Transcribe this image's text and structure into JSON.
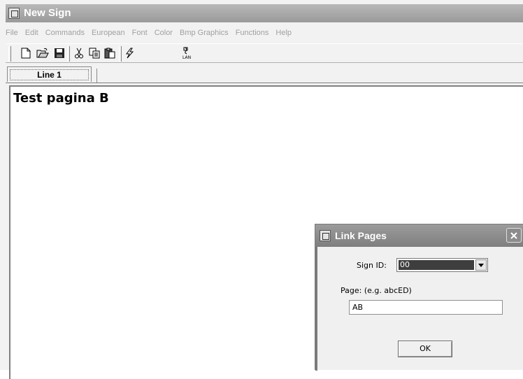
{
  "window": {
    "title": "New Sign"
  },
  "menu": {
    "items": [
      "File",
      "Edit",
      "Commands",
      "European",
      "Font",
      "Color",
      "Bmp Graphics",
      "Functions",
      "Help"
    ]
  },
  "toolbar": {
    "icons": [
      "new-document-icon",
      "open-folder-icon",
      "save-disk-icon",
      "cut-icon",
      "copy-icon",
      "paste-icon",
      "send-lightning-icon",
      "lan-connection-icon"
    ]
  },
  "tabs": [
    {
      "label": "Line 1",
      "active": true
    }
  ],
  "editor": {
    "text": "Test pagina B"
  },
  "dialog": {
    "title": "Link Pages",
    "sign_id_label": "Sign ID:",
    "sign_id_value": "00",
    "page_label": "Page: (e.g. abcED)",
    "page_value": "AB",
    "ok_label": "OK"
  }
}
